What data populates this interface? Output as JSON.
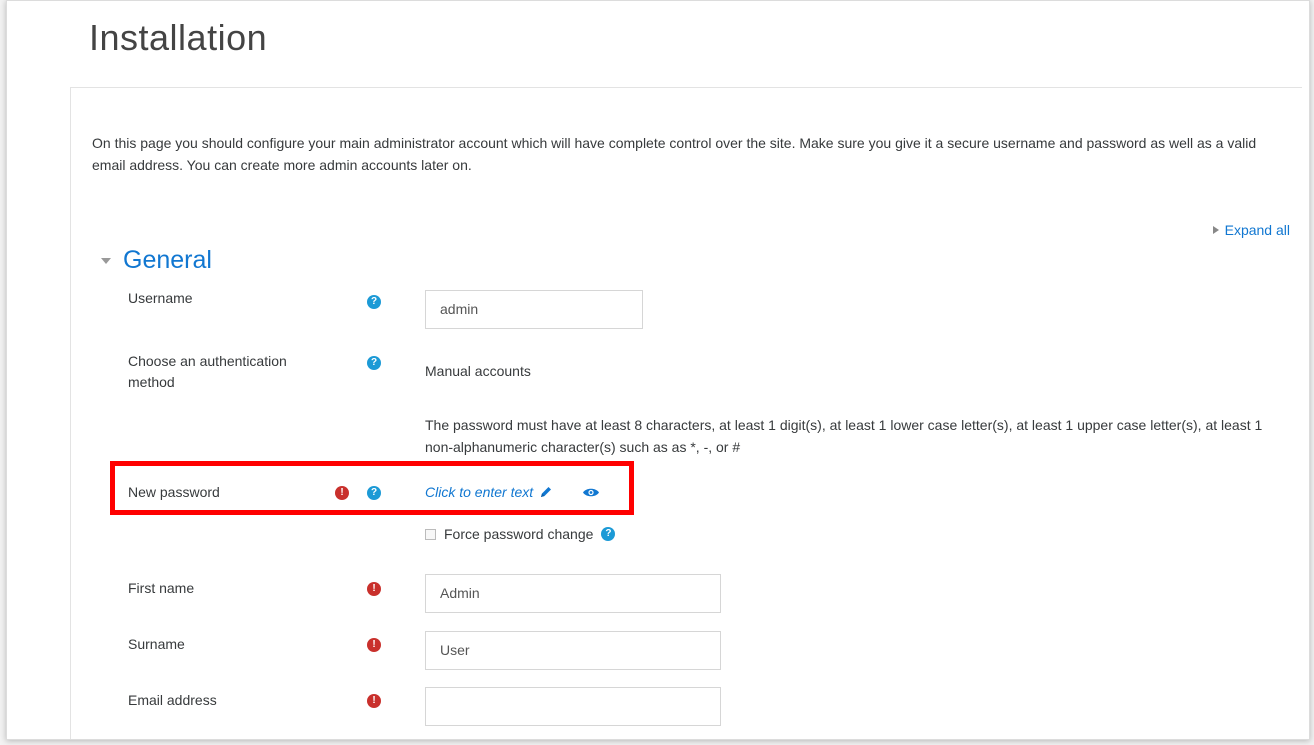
{
  "page": {
    "title": "Installation",
    "intro": "On this page you should configure your main administrator account which will have complete control over the site. Make sure you give it a secure username and password as well as a valid email address. You can create more admin accounts later on."
  },
  "toolbar": {
    "expand_all": "Expand all"
  },
  "section": {
    "title": "General"
  },
  "fields": {
    "username": {
      "label": "Username",
      "value": "admin"
    },
    "auth": {
      "label": "Choose an authentication method",
      "value": "Manual accounts"
    },
    "password_hint": "The password must have at least 8 characters, at least 1 digit(s), at least 1 lower case letter(s), at least 1 upper case letter(s), at least 1 non-alphanumeric character(s) such as as *, -, or #",
    "new_password": {
      "label": "New password",
      "link": "Click to enter text"
    },
    "force_change": {
      "label": "Force password change",
      "checked": false
    },
    "first_name": {
      "label": "First name",
      "value": "Admin"
    },
    "surname": {
      "label": "Surname",
      "value": "User"
    },
    "email": {
      "label": "Email address",
      "value": ""
    }
  },
  "icons": {
    "help": "?",
    "required": "!"
  },
  "colors": {
    "link": "#1177d1",
    "help": "#1c9ad6",
    "required": "#c9302c",
    "highlight": "#ff0000"
  }
}
